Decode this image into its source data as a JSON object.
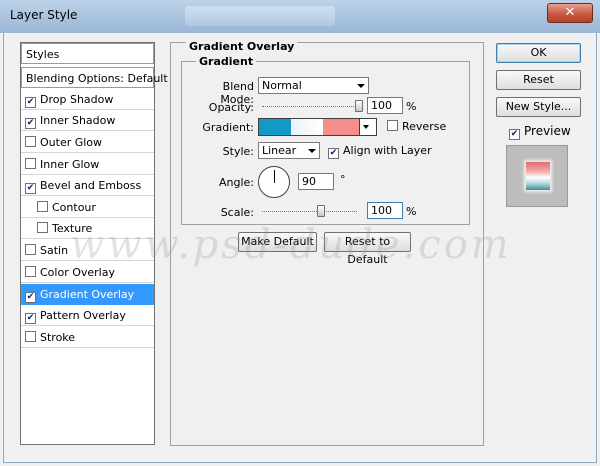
{
  "window": {
    "title": "Layer Style",
    "close_glyph": "✕"
  },
  "styles_list": {
    "header": "Styles",
    "blending": "Blending Options: Default",
    "items": [
      {
        "label": "Drop Shadow",
        "checked": true
      },
      {
        "label": "Inner Shadow",
        "checked": true
      },
      {
        "label": "Outer Glow",
        "checked": false
      },
      {
        "label": "Inner Glow",
        "checked": false
      },
      {
        "label": "Bevel and Emboss",
        "checked": true
      },
      {
        "label": "Contour",
        "checked": false
      },
      {
        "label": "Texture",
        "checked": false
      },
      {
        "label": "Satin",
        "checked": false
      },
      {
        "label": "Color Overlay",
        "checked": false
      },
      {
        "label": "Gradient Overlay",
        "checked": true
      },
      {
        "label": "Pattern Overlay",
        "checked": true
      },
      {
        "label": "Stroke",
        "checked": false
      }
    ]
  },
  "panel": {
    "section_title": "Gradient Overlay",
    "group_title": "Gradient",
    "blend_mode_label": "Blend Mode:",
    "blend_mode_value": "Normal",
    "opacity_label": "Opacity:",
    "opacity_value": "100",
    "opacity_unit": "%",
    "gradient_label": "Gradient:",
    "reverse_label": "Reverse",
    "style_label": "Style:",
    "style_value": "Linear",
    "align_label": "Align with Layer",
    "angle_label": "Angle:",
    "angle_value": "90",
    "angle_unit": "°",
    "scale_label": "Scale:",
    "scale_value": "100",
    "scale_unit": "%",
    "make_default": "Make Default",
    "reset_default": "Reset to Default"
  },
  "sidebar_buttons": {
    "ok": "OK",
    "reset": "Reset",
    "new_style": "New Style...",
    "preview_label": "Preview"
  },
  "watermark": "www.psd-dude.com",
  "colors": {
    "gradient_stops": [
      "#1399c7",
      "#ffffff",
      "#f58d8a"
    ],
    "selection": "#3399ff"
  }
}
